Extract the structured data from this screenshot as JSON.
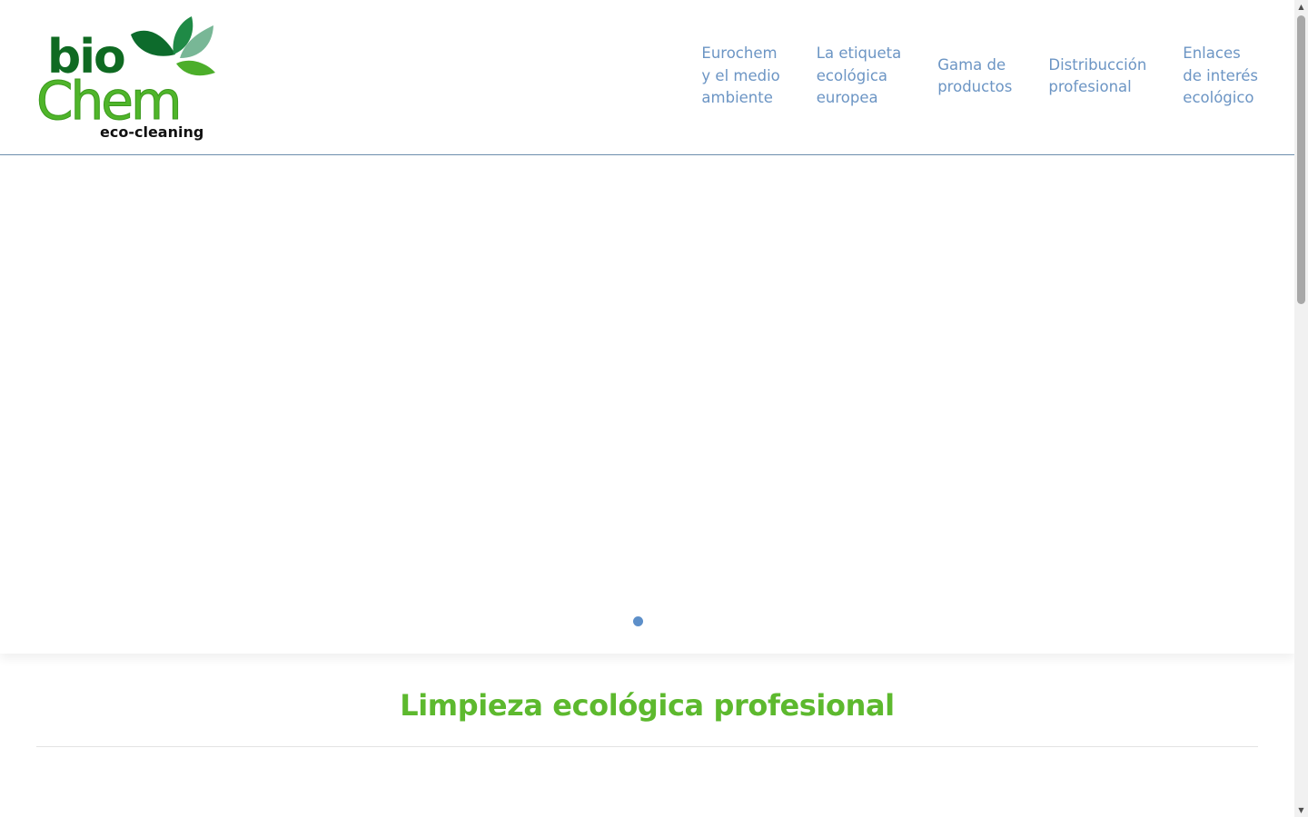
{
  "header": {
    "logo": {
      "word1": "bio",
      "word2": "Chem",
      "tagline": "eco-cleaning"
    },
    "nav": [
      {
        "label": "Eurochem\ny el medio\nambiente"
      },
      {
        "label": "La etiqueta\necológica\neuropea"
      },
      {
        "label": "Gama de\nproductos"
      },
      {
        "label": "Distribucción\nprofesional"
      },
      {
        "label": "Enlaces\nde interés\necológico"
      }
    ]
  },
  "slider": {
    "active_slide": 1,
    "slide_count": 1
  },
  "main": {
    "title": "Limpieza ecológica profesional"
  },
  "colors": {
    "nav_link": "#6c95c4",
    "title_green": "#5db92e",
    "logo_dark_green": "#1f7a1f",
    "logo_light_green": "#5ab52a",
    "dot_blue": "#5d8fc9"
  },
  "scrollbar": {
    "up_icon": "▲",
    "down_icon": "▼"
  }
}
